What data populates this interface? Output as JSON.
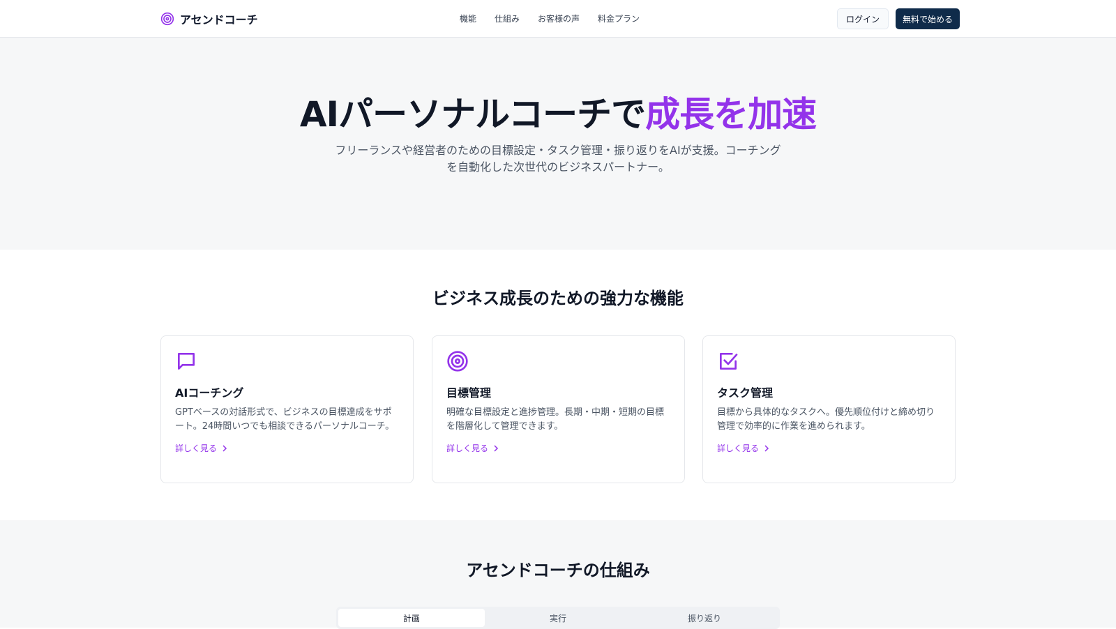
{
  "nav": {
    "brand": "アセンドコーチ",
    "brand_icon": "target-icon",
    "links": [
      "機能",
      "仕組み",
      "お客様の声",
      "料金プラン"
    ],
    "login_label": "ログイン",
    "start_label": "無料で始める"
  },
  "hero": {
    "title_main": "AIパーソナルコーチで",
    "title_accent": "成長を加速",
    "subtitle": "フリーランスや経営者のための目標設定・タスク管理・振り返りをAIが支援。コーチングを自動化した次世代のビジネスパートナー。"
  },
  "features": {
    "title": "ビジネス成長のための強力な機能",
    "cards": [
      {
        "icon": "chat-bubble-icon",
        "title": "AIコーチング",
        "desc": "GPTベースの対話形式で、ビジネスの目標達成をサポート。24時間いつでも相談できるパーソナルコーチ。",
        "link": "詳しく見る"
      },
      {
        "icon": "target-icon",
        "title": "目標管理",
        "desc": "明確な目標設定と進捗管理。長期・中期・短期の目標を階層化して管理できます。",
        "link": "詳しく見る"
      },
      {
        "icon": "checkbox-icon",
        "title": "タスク管理",
        "desc": "目標から具体的なタスクへ。優先順位付けと締め切り管理で効率的に作業を進められます。",
        "link": "詳しく見る"
      }
    ]
  },
  "how": {
    "title": "アセンドコーチの仕組み",
    "tabs": [
      "計画",
      "実行",
      "振り返り"
    ],
    "active_tab": "計画"
  },
  "colors": {
    "accent": "#9333ea",
    "primary_button": "#0f2b4a",
    "section_bg": "#f6f7f8"
  }
}
